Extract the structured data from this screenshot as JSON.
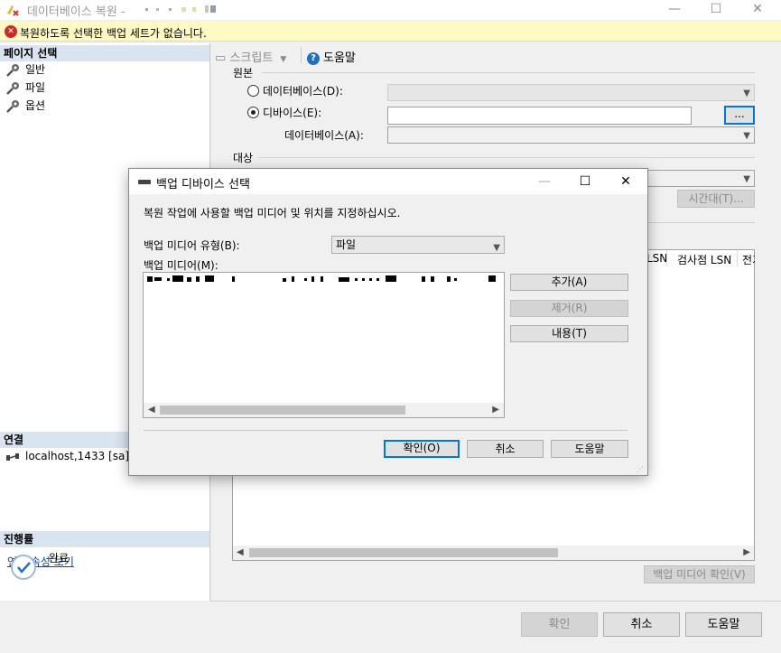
{
  "window": {
    "title": "데이터베이스 복원 - ",
    "minimize": "—",
    "maximize": "☐",
    "close": "✕"
  },
  "error_bar": {
    "icon": "error-icon",
    "text": "복원하도록 선택한 백업 세트가 없습니다."
  },
  "left_panel": {
    "select_page_header": "페이지 선택",
    "pages": [
      {
        "label": "일반",
        "icon": "wrench-icon"
      },
      {
        "label": "파일",
        "icon": "wrench-icon"
      },
      {
        "label": "옵션",
        "icon": "wrench-icon"
      }
    ],
    "connection_header": "연결",
    "connection": "localhost,1433 [sa]",
    "view_connection_properties": "연결 속성 보기",
    "progress_header": "진행률",
    "progress_status": "완료"
  },
  "toolbar": {
    "script": "스크립트",
    "help": "도움말"
  },
  "source": {
    "group_label": "원본",
    "database_radio": "데이터베이스(D):",
    "device_radio": "디바이스(E):",
    "selected": "device",
    "device_value": "",
    "browse_button": "...",
    "database_label": "데이터베이스(A):"
  },
  "destination": {
    "group_label": "대상",
    "timeline_button": "시간대(T)..."
  },
  "backup_grid": {
    "headers": [
      "LSN",
      "검사점 LSN",
      "전기"
    ]
  },
  "verify_button": "백업 미디어 확인(V)",
  "footer": {
    "ok": "확인",
    "cancel": "취소",
    "help": "도움말"
  },
  "dialog": {
    "title": "백업 디바이스 선택",
    "instruction": "복원 작업에 사용할 백업 미디어 및 위치를 지정하십시오.",
    "media_type_label": "백업 미디어 유형(B):",
    "media_type_value": "파일",
    "media_label": "백업 미디어(M):",
    "add_button": "추가(A)",
    "remove_button": "제거(R)",
    "contents_button": "내용(T)",
    "ok_button": "확인(O)",
    "cancel_button": "취소",
    "help_button": "도움말"
  }
}
